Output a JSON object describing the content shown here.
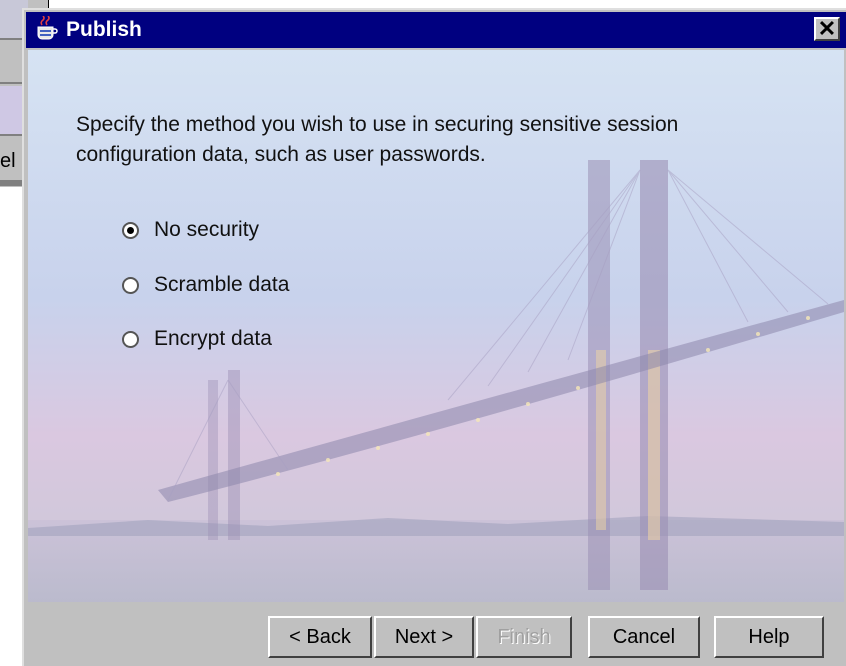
{
  "background_window": {
    "label_fragment": "el"
  },
  "dialog": {
    "title": "Publish",
    "close_glyph": "✕",
    "prompt": "Specify the method you wish to use in securing sensitive session configuration data, such as user passwords.",
    "security_options": [
      {
        "label": "No security",
        "selected": true
      },
      {
        "label": "Scramble data",
        "selected": false
      },
      {
        "label": "Encrypt data",
        "selected": false
      }
    ],
    "buttons": {
      "back": "< Back",
      "next": "Next >",
      "finish": "Finish",
      "cancel": "Cancel",
      "help": "Help"
    },
    "finish_enabled": false
  },
  "colors": {
    "titlebar": "#000080",
    "face": "#c0c0c0"
  },
  "icons": {
    "app": "java-cup-icon",
    "close": "close-icon"
  }
}
